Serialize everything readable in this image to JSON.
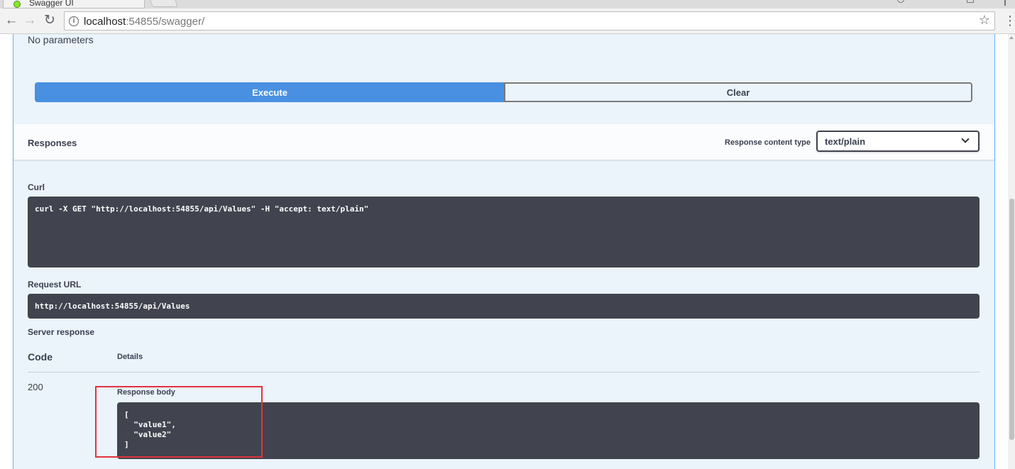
{
  "browser": {
    "tab_title": "Swagger UI",
    "url_host": "localhost",
    "url_path": ":54855/swagger/",
    "back_icon": "←",
    "forward_icon": "→",
    "reload_icon": "↻",
    "star_icon": "☆",
    "menu_icon": "⋮"
  },
  "operation": {
    "no_parameters": "No parameters",
    "execute_label": "Execute",
    "clear_label": "Clear"
  },
  "responses": {
    "title": "Responses",
    "content_type_label": "Response content type",
    "content_type_value": "text/plain"
  },
  "curl": {
    "label": "Curl",
    "command": "curl -X GET \"http://localhost:54855/api/Values\" -H \"accept: text/plain\""
  },
  "request_url": {
    "label": "Request URL",
    "value": "http://localhost:54855/api/Values"
  },
  "server_response": {
    "label": "Server response",
    "col_code": "Code",
    "col_details": "Details",
    "status_code": "200",
    "response_body_label": "Response body",
    "response_body": "[\n  \"value1\",\n  \"value2\"\n]"
  },
  "colors": {
    "execute_button": "#4990e2",
    "panel_background": "#ebf3fb",
    "code_background": "#41444e",
    "highlight_border": "#e0353b"
  }
}
